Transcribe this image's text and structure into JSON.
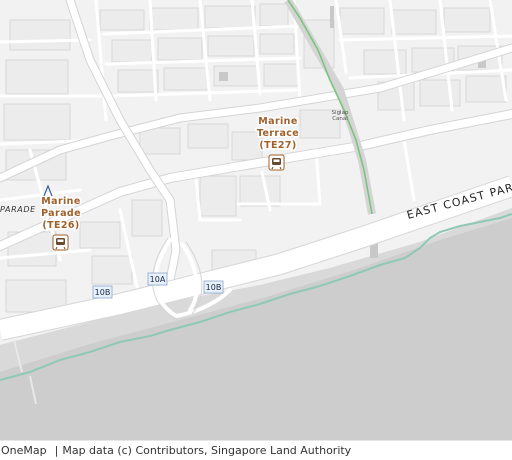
{
  "map": {
    "stations": [
      {
        "name_line1": "Marine",
        "name_line2": "Terrace",
        "code": "(TE27)"
      },
      {
        "name_line1": "Marine",
        "name_line2": "Parade",
        "code": "(TE26)"
      }
    ],
    "road_labels": {
      "expressway": "EAST COAST PAR",
      "parade_partial": "PARADE"
    },
    "canal_label_line1": "Siglap",
    "canal_label_line2": "Canal",
    "exit_markers": [
      "10A",
      "10B",
      "10B"
    ],
    "icons": [
      "mrt-station-icon",
      "mrt-station-icon"
    ],
    "colors": {
      "land": "#f2f2f2",
      "block": "#ececec",
      "road": "#ffffff",
      "road_outline": "#d4d4d4",
      "sea": "#cdcdcd",
      "green_line": "#7cc47c",
      "coast_line": "#8fc9b3",
      "station_label": "#a0602a"
    }
  },
  "attribution": {
    "brand": "OneMap",
    "separator": "|",
    "text": "Map data (c) Contributors, Singapore Land Authority"
  }
}
